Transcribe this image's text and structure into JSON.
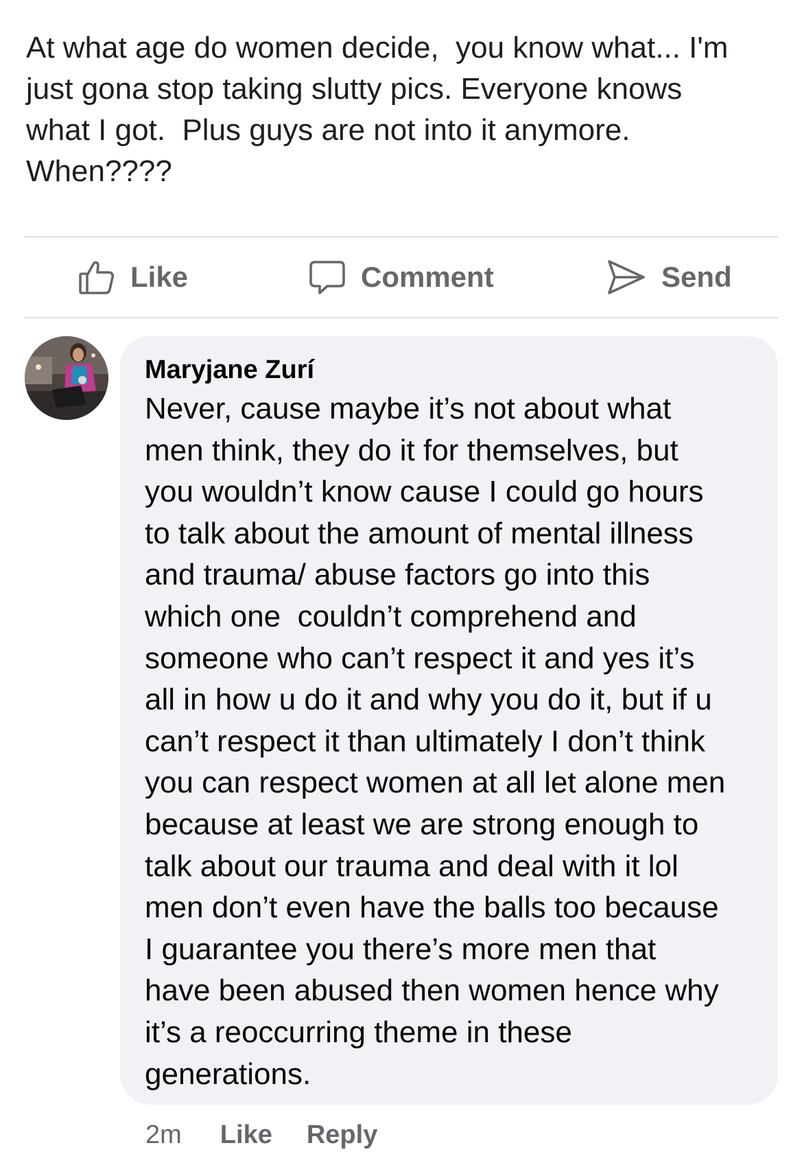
{
  "post": {
    "text": "At what age do women decide,  you know what... I'm\njust gona stop taking slutty pics. Everyone knows\nwhat I got.  Plus guys are not into it anymore.\nWhen????"
  },
  "actions": {
    "like_label": "Like",
    "comment_label": "Comment",
    "send_label": "Send"
  },
  "comment": {
    "author": "Maryjane Zurí",
    "text": "Never, cause maybe it’s not about what\nmen think, they do it for themselves, but\nyou wouldn’t know cause I could go hours\nto talk about the amount of mental illness\nand trauma/ abuse factors go into this\nwhich one  couldn’t comprehend and\nsomeone who can’t respect it and yes it’s\nall in how u do it and why you do it, but if u\ncan’t respect it than ultimately I don’t think\nyou can respect women at all let alone men\nbecause at least we are strong enough to\ntalk about our trauma and deal with it lol\nmen don’t even have the balls too because\nI guarantee you there’s more men that\nhave been abused then women hence why\nit’s a reoccurring theme in these\ngenerations.",
    "time": "2m",
    "like_label": "Like",
    "reply_label": "Reply"
  },
  "colors": {
    "bubble_bg": "#f0f2f5",
    "secondary_text": "#65676b",
    "divider": "#dadde1"
  }
}
